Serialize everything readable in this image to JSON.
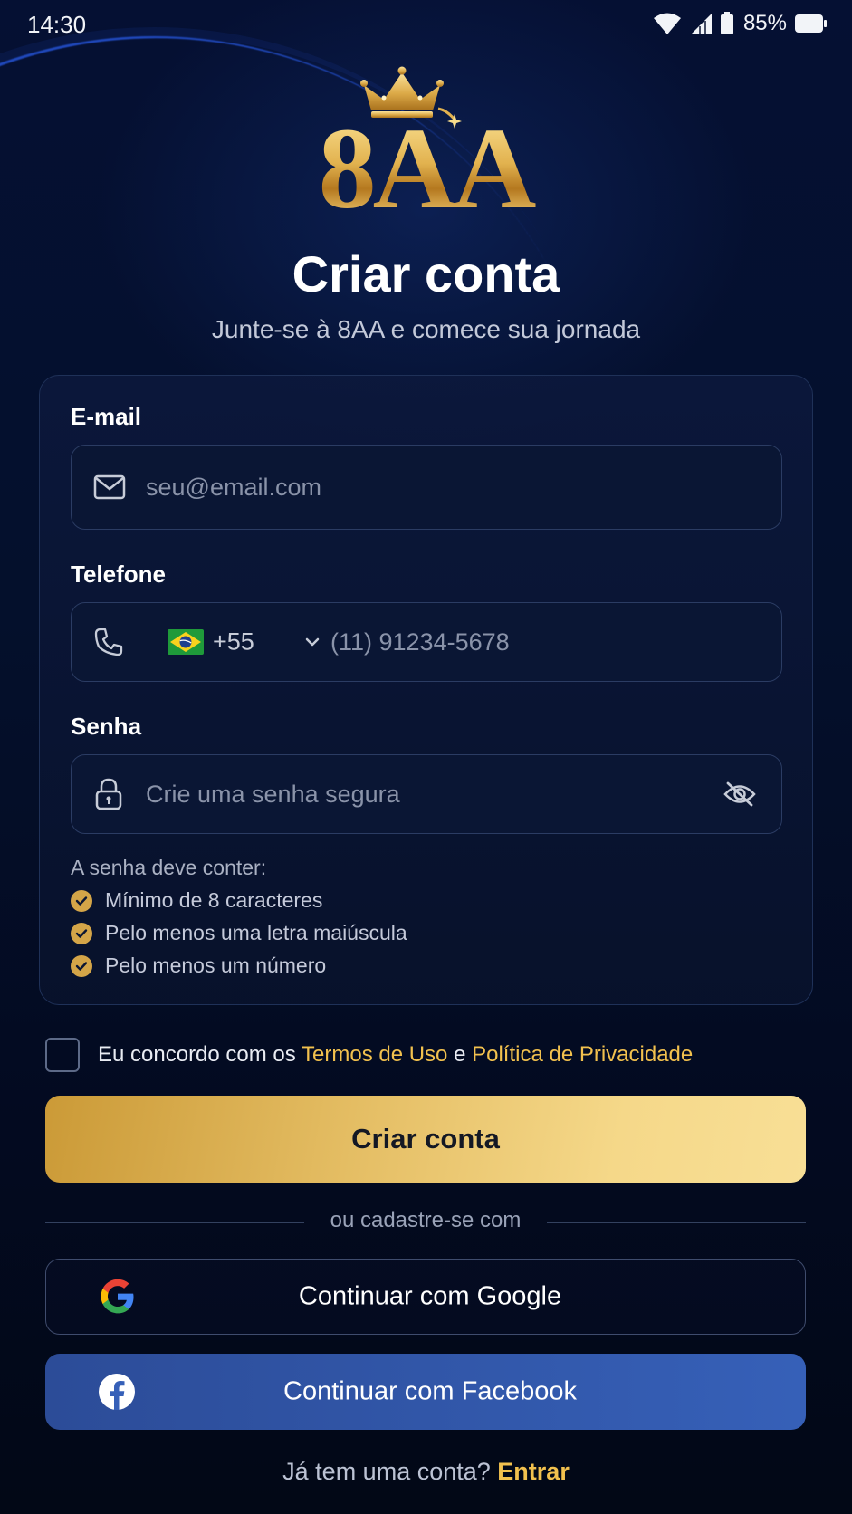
{
  "status_bar": {
    "time": "14:30",
    "battery": "85%"
  },
  "brand": {
    "logo_text": "8AA"
  },
  "header": {
    "title": "Criar conta",
    "subtitle": "Junte-se à 8AA e comece sua jornada"
  },
  "form": {
    "email": {
      "label": "E-mail",
      "placeholder": "seu@email.com",
      "value": ""
    },
    "phone": {
      "label": "Telefone",
      "country_code": "+55",
      "country_flag": "brazil-flag-icon",
      "placeholder": "(11) 91234-5678",
      "value": ""
    },
    "password": {
      "label": "Senha",
      "placeholder": "Crie uma senha segura",
      "value": "",
      "visibility_icon": "eye-off-icon"
    },
    "requirements": {
      "title": "A senha deve conter:",
      "items": [
        "Mínimo de 8 caracteres",
        "Pelo menos uma letra maiúscula",
        "Pelo menos um número"
      ]
    }
  },
  "terms": {
    "checked": false,
    "prefix": "Eu concordo com os",
    "terms_link": "Termos de Uso",
    "conjunction": "e",
    "privacy_link": "Política de Privacidade"
  },
  "actions": {
    "create_account": "Criar conta",
    "divider": "ou cadastre-se com",
    "google": "Continuar com Google",
    "facebook": "Continuar com Facebook"
  },
  "footer": {
    "prompt": "Já tem uma conta?",
    "login_link": "Entrar"
  },
  "colors": {
    "accent_gold": "#f2c14e",
    "background": "#040a1e",
    "facebook_blue": "#3360b8"
  }
}
